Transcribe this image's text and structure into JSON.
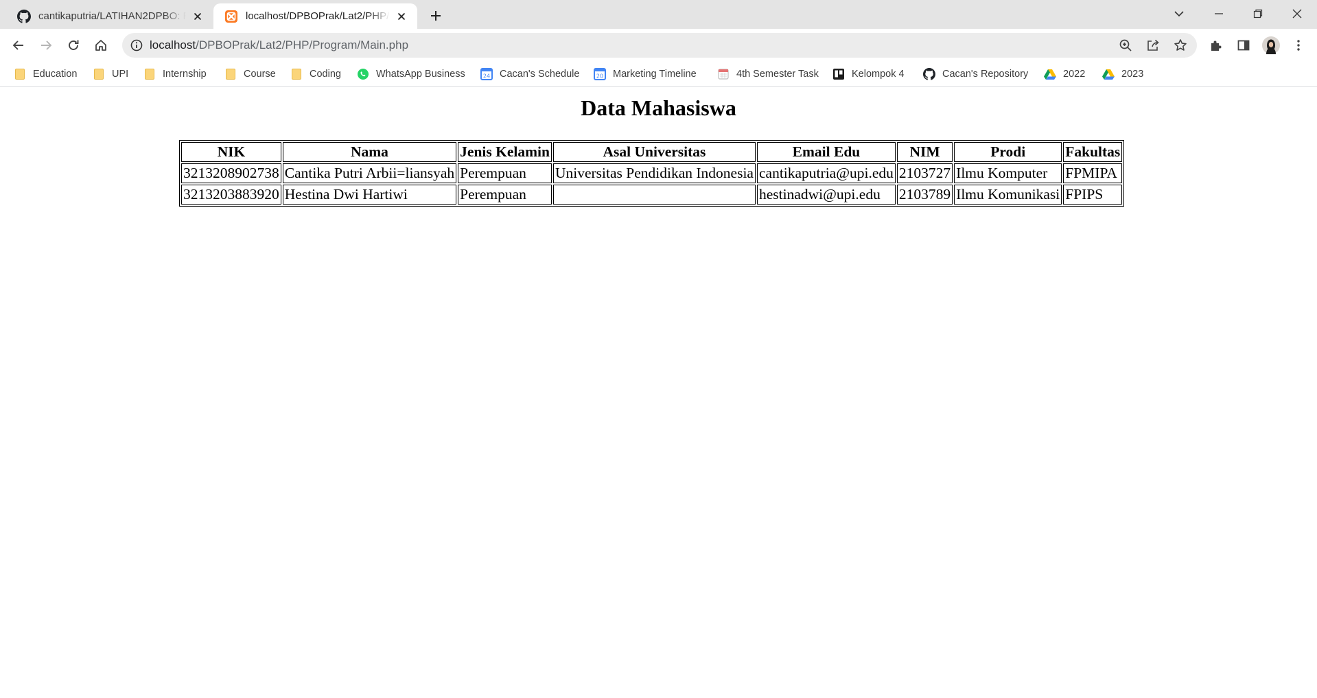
{
  "browser": {
    "tabs": [
      {
        "title": "cantikaputria/LATIHAN2DPBO: Re",
        "icon": "github-icon",
        "active": false
      },
      {
        "title": "localhost/DPBOPrak/Lat2/PHP/Pr",
        "icon": "xampp-icon",
        "active": true
      }
    ],
    "new_tab_label": "+",
    "omnibox": {
      "url_host": "localhost",
      "url_path": "/DPBOPrak/Lat2/PHP/Program/Main.php"
    },
    "bookmarks": [
      {
        "label": "Education",
        "icon": "folder-icon"
      },
      {
        "label": "UPI",
        "icon": "folder-icon"
      },
      {
        "label": "Internship",
        "icon": "folder-icon"
      },
      {
        "label": "Course",
        "icon": "folder-icon"
      },
      {
        "label": "Coding",
        "icon": "folder-icon"
      },
      {
        "label": "WhatsApp Business",
        "icon": "whatsapp-icon"
      },
      {
        "label": "Cacan's Schedule",
        "icon": "google-calendar-icon"
      },
      {
        "label": "Marketing Timeline",
        "icon": "google-calendar-icon"
      },
      {
        "label": "4th Semester Task",
        "icon": "calendar-icon"
      },
      {
        "label": "Kelompok 4",
        "icon": "trello-icon"
      },
      {
        "label": "Cacan's Repository",
        "icon": "github-icon"
      },
      {
        "label": "2022",
        "icon": "google-drive-icon"
      },
      {
        "label": "2023",
        "icon": "google-drive-icon"
      }
    ],
    "colors": {
      "tabstrip": "#e4e4e4",
      "omnibox": "#ececec",
      "folder": "#fbd57a"
    }
  },
  "page": {
    "title": "Data Mahasiswa",
    "table": {
      "headers": [
        "NIK",
        "Nama",
        "Jenis Kelamin",
        "Asal Universitas",
        "Email Edu",
        "NIM",
        "Prodi",
        "Fakultas"
      ],
      "rows": [
        [
          "3213208902738",
          "Cantika Putri Arbii=liansyah",
          "Perempuan",
          "Universitas Pendidikan Indonesia",
          "cantikaputria@upi.edu",
          "2103727",
          "Ilmu Komputer",
          "FPMIPA"
        ],
        [
          "3213203883920",
          "Hestina Dwi Hartiwi",
          "Perempuan",
          "",
          "hestinadwi@upi.edu",
          "2103789",
          "Ilmu Komunikasi",
          "FPIPS"
        ]
      ]
    }
  }
}
